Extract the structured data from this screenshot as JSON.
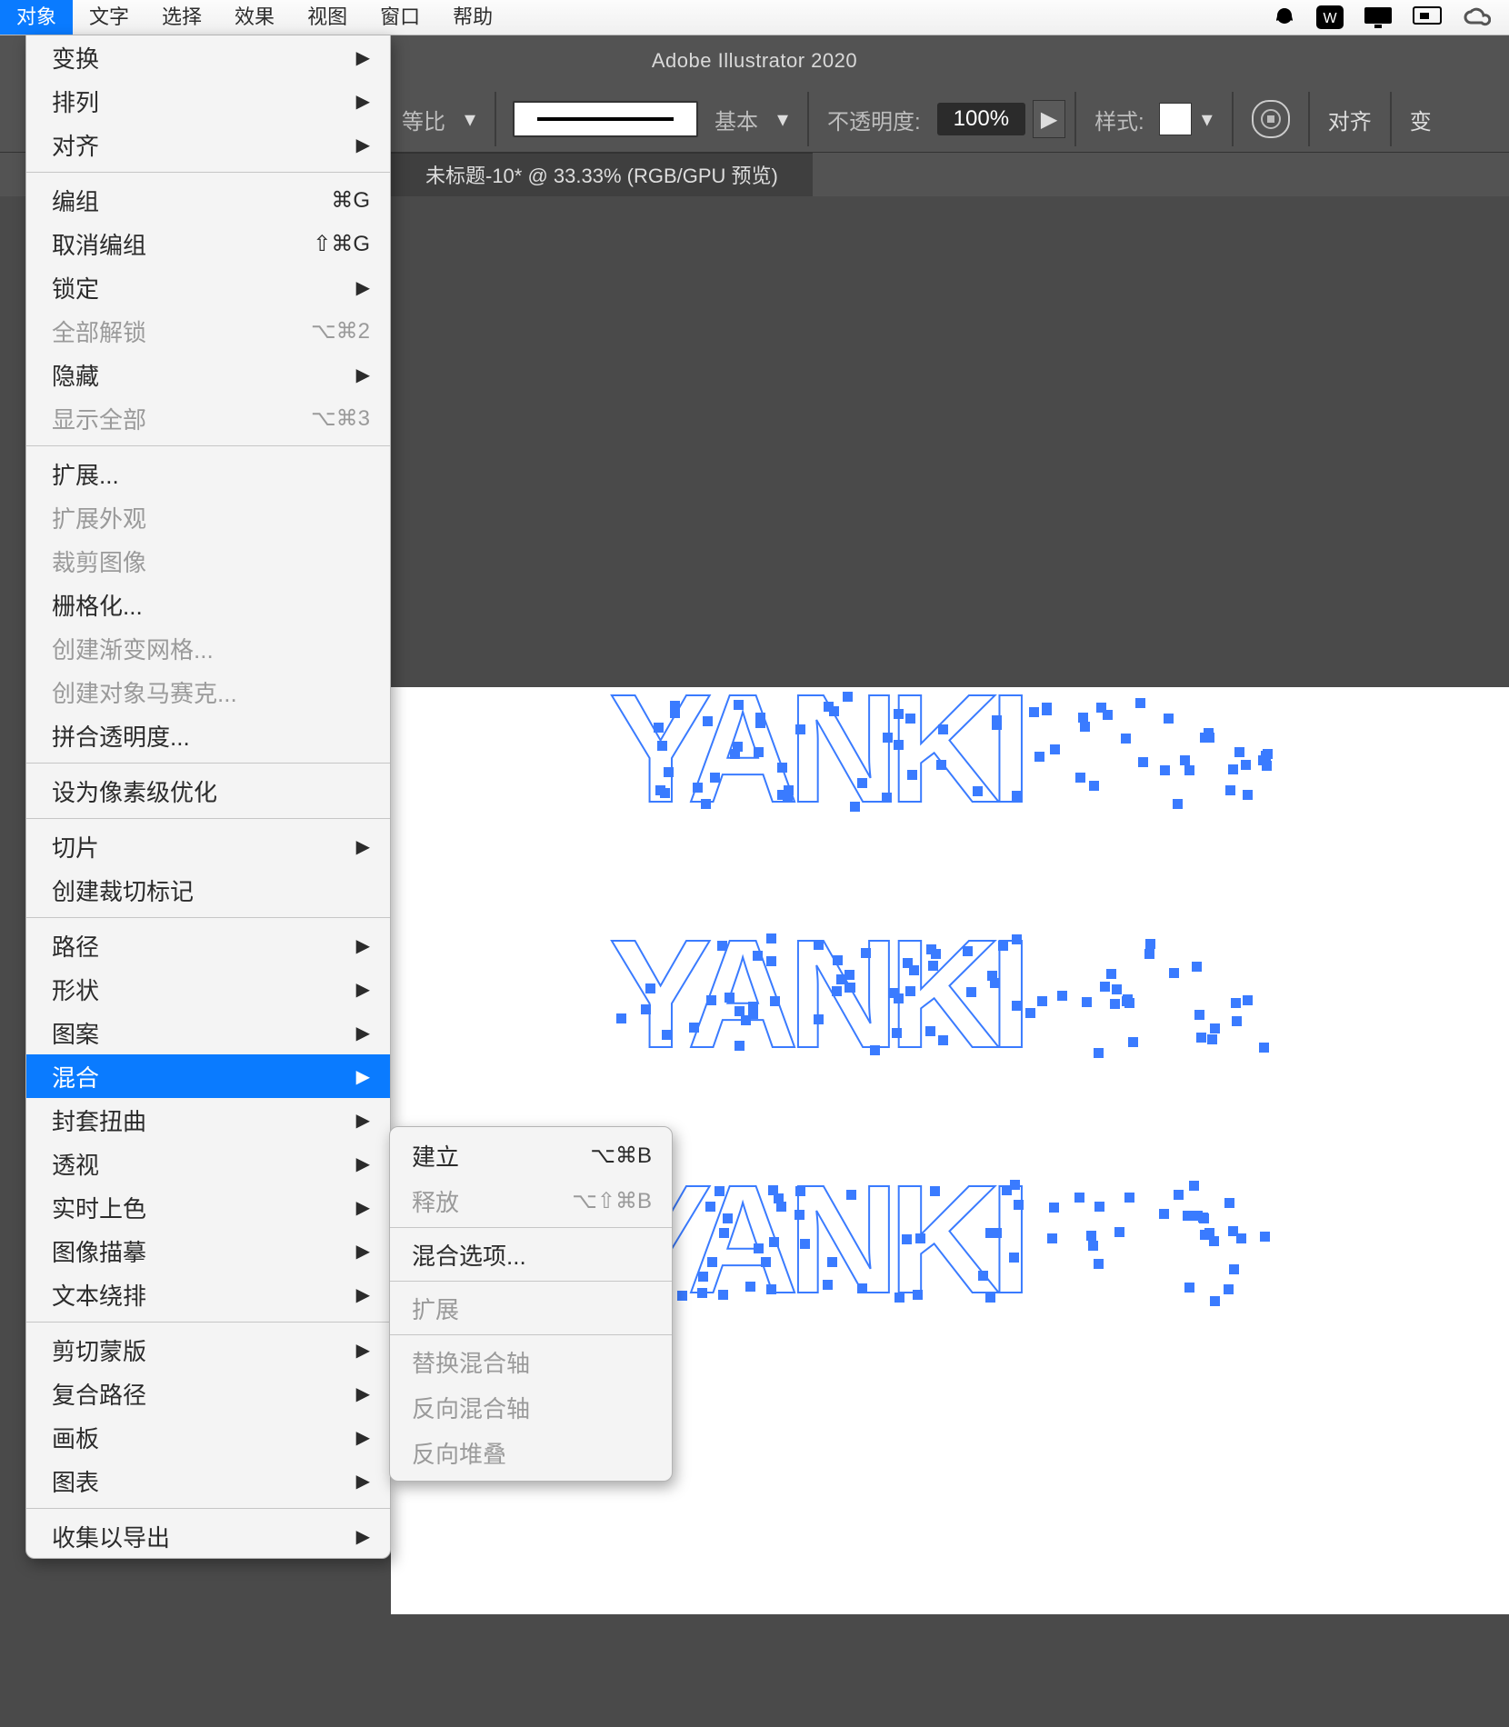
{
  "menubar": {
    "items": [
      "对象",
      "文字",
      "选择",
      "效果",
      "视图",
      "窗口",
      "帮助"
    ],
    "selected_index": 0
  },
  "titlebar": "Adobe Illustrator 2020",
  "optbar": {
    "scale_label": "等比",
    "stroke_label": "基本",
    "opacity_label": "不透明度:",
    "opacity_value": "100%",
    "style_label": "样式:",
    "align_label": "对齐",
    "more_label": "变"
  },
  "tab": {
    "label": "未标题-10* @ 33.33% (RGB/GPU 预览)"
  },
  "canvas_text": "YANKI",
  "dropdown": {
    "sections": [
      {
        "rows": [
          {
            "label": "变换",
            "sub": true
          },
          {
            "label": "排列",
            "sub": true
          },
          {
            "label": "对齐",
            "sub": true
          }
        ]
      },
      {
        "rows": [
          {
            "label": "编组",
            "sc": "⌘G"
          },
          {
            "label": "取消编组",
            "sc": "⇧⌘G"
          },
          {
            "label": "锁定",
            "sub": true
          },
          {
            "label": "全部解锁",
            "sc": "⌥⌘2",
            "disabled": true
          },
          {
            "label": "隐藏",
            "sub": true
          },
          {
            "label": "显示全部",
            "sc": "⌥⌘3",
            "disabled": true
          }
        ]
      },
      {
        "rows": [
          {
            "label": "扩展..."
          },
          {
            "label": "扩展外观",
            "disabled": true
          },
          {
            "label": "裁剪图像",
            "disabled": true
          },
          {
            "label": "栅格化..."
          },
          {
            "label": "创建渐变网格...",
            "disabled": true
          },
          {
            "label": "创建对象马赛克...",
            "disabled": true
          },
          {
            "label": "拼合透明度..."
          }
        ]
      },
      {
        "rows": [
          {
            "label": "设为像素级优化"
          }
        ]
      },
      {
        "rows": [
          {
            "label": "切片",
            "sub": true
          },
          {
            "label": "创建裁切标记"
          }
        ]
      },
      {
        "rows": [
          {
            "label": "路径",
            "sub": true
          },
          {
            "label": "形状",
            "sub": true
          },
          {
            "label": "图案",
            "sub": true
          },
          {
            "label": "混合",
            "sub": true,
            "highlight": true
          },
          {
            "label": "封套扭曲",
            "sub": true
          },
          {
            "label": "透视",
            "sub": true
          },
          {
            "label": "实时上色",
            "sub": true
          },
          {
            "label": "图像描摹",
            "sub": true
          },
          {
            "label": "文本绕排",
            "sub": true
          }
        ]
      },
      {
        "rows": [
          {
            "label": "剪切蒙版",
            "sub": true
          },
          {
            "label": "复合路径",
            "sub": true
          },
          {
            "label": "画板",
            "sub": true
          },
          {
            "label": "图表",
            "sub": true
          }
        ]
      },
      {
        "rows": [
          {
            "label": "收集以导出",
            "sub": true
          }
        ]
      }
    ]
  },
  "subdrop": {
    "sections": [
      {
        "rows": [
          {
            "label": "建立",
            "sc": "⌥⌘B"
          },
          {
            "label": "释放",
            "sc": "⌥⇧⌘B",
            "disabled": true
          }
        ]
      },
      {
        "rows": [
          {
            "label": "混合选项..."
          }
        ]
      },
      {
        "rows": [
          {
            "label": "扩展",
            "disabled": true
          }
        ]
      },
      {
        "rows": [
          {
            "label": "替换混合轴",
            "disabled": true
          },
          {
            "label": "反向混合轴",
            "disabled": true
          },
          {
            "label": "反向堆叠",
            "disabled": true
          }
        ]
      }
    ]
  }
}
